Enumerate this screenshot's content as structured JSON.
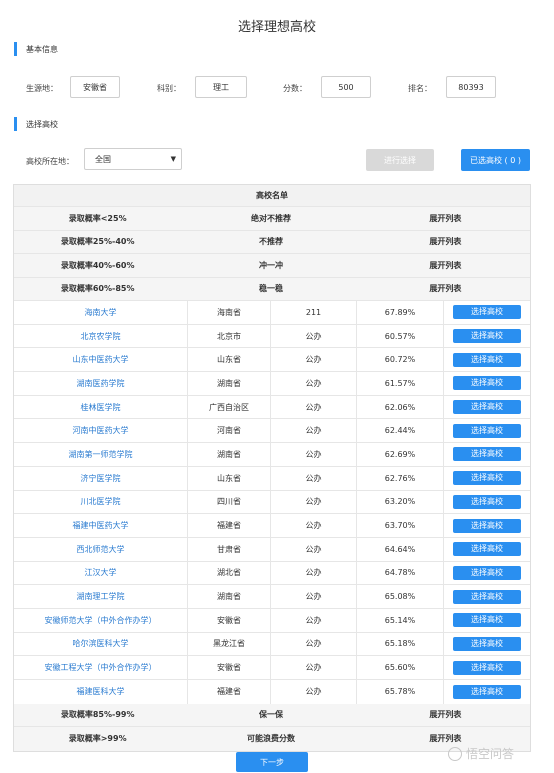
{
  "page_title": "选择理想高校",
  "sections": {
    "basic_info": "基本信息",
    "choose_school": "选择高校"
  },
  "form": {
    "origin_label": "生源地：",
    "origin_value": "安徽省",
    "subject_label": "科别：",
    "subject_value": "理工",
    "score_label": "分数：",
    "score_value": "500",
    "rank_label": "排名：",
    "rank_value": "80393"
  },
  "filter": {
    "location_label": "高校所在地：",
    "location_value": "全国",
    "select_button": "进行选择",
    "selected_button": "已选高校 ( 0 )"
  },
  "table": {
    "title": "高校名单",
    "categories_top": [
      {
        "range": "录取概率<25%",
        "desc": "绝对不推荐",
        "action": "展开列表"
      },
      {
        "range": "录取概率25%-40%",
        "desc": "不推荐",
        "action": "展开列表"
      },
      {
        "range": "录取概率40%-60%",
        "desc": "冲一冲",
        "action": "展开列表"
      },
      {
        "range": "录取概率60%-85%",
        "desc": "稳一稳",
        "action": "展开列表"
      }
    ],
    "schools": [
      {
        "name": "海南大学",
        "province": "海南省",
        "type": "211",
        "rate": "67.89%",
        "action": "选择高校"
      },
      {
        "name": "北京农学院",
        "province": "北京市",
        "type": "公办",
        "rate": "60.57%",
        "action": "选择高校"
      },
      {
        "name": "山东中医药大学",
        "province": "山东省",
        "type": "公办",
        "rate": "60.72%",
        "action": "选择高校"
      },
      {
        "name": "湖南医药学院",
        "province": "湖南省",
        "type": "公办",
        "rate": "61.57%",
        "action": "选择高校"
      },
      {
        "name": "桂林医学院",
        "province": "广西自治区",
        "type": "公办",
        "rate": "62.06%",
        "action": "选择高校"
      },
      {
        "name": "河南中医药大学",
        "province": "河南省",
        "type": "公办",
        "rate": "62.44%",
        "action": "选择高校"
      },
      {
        "name": "湖南第一师范学院",
        "province": "湖南省",
        "type": "公办",
        "rate": "62.69%",
        "action": "选择高校"
      },
      {
        "name": "济宁医学院",
        "province": "山东省",
        "type": "公办",
        "rate": "62.76%",
        "action": "选择高校"
      },
      {
        "name": "川北医学院",
        "province": "四川省",
        "type": "公办",
        "rate": "63.20%",
        "action": "选择高校"
      },
      {
        "name": "福建中医药大学",
        "province": "福建省",
        "type": "公办",
        "rate": "63.70%",
        "action": "选择高校"
      },
      {
        "name": "西北师范大学",
        "province": "甘肃省",
        "type": "公办",
        "rate": "64.64%",
        "action": "选择高校"
      },
      {
        "name": "江汉大学",
        "province": "湖北省",
        "type": "公办",
        "rate": "64.78%",
        "action": "选择高校"
      },
      {
        "name": "湖南理工学院",
        "province": "湖南省",
        "type": "公办",
        "rate": "65.08%",
        "action": "选择高校"
      },
      {
        "name": "安徽师范大学（中外合作办学）",
        "province": "安徽省",
        "type": "公办",
        "rate": "65.14%",
        "action": "选择高校"
      },
      {
        "name": "哈尔滨医科大学",
        "province": "黑龙江省",
        "type": "公办",
        "rate": "65.18%",
        "action": "选择高校"
      },
      {
        "name": "安徽工程大学（中外合作办学）",
        "province": "安徽省",
        "type": "公办",
        "rate": "65.60%",
        "action": "选择高校"
      },
      {
        "name": "福建医科大学",
        "province": "福建省",
        "type": "公办",
        "rate": "65.78%",
        "action": "选择高校"
      }
    ],
    "categories_bottom": [
      {
        "range": "录取概率85%-99%",
        "desc": "保一保",
        "action": "展开列表"
      },
      {
        "range": "录取概率>99%",
        "desc": "可能浪费分数",
        "action": "展开列表"
      }
    ]
  },
  "next_button": "下一步",
  "watermark": "悟空问答"
}
